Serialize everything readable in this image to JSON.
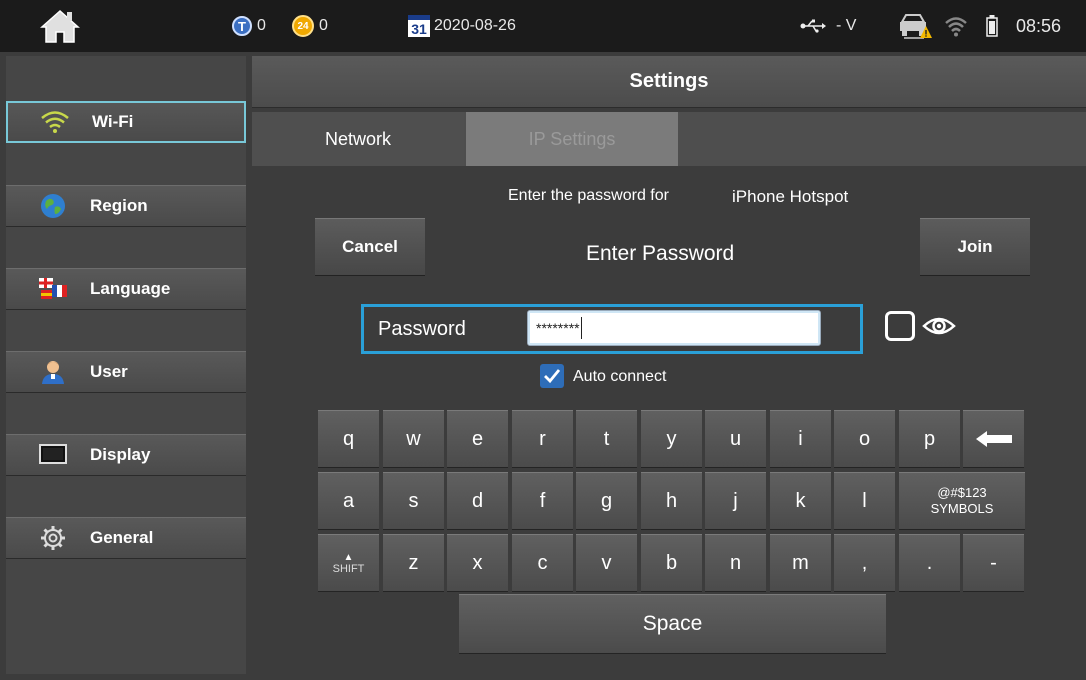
{
  "status_bar": {
    "t_badge": "T",
    "t_count": "0",
    "badge_24": "24",
    "count_24": "0",
    "calendar_day": "31",
    "date": "2020-08-26",
    "voltage": "- V",
    "time": "08:56"
  },
  "sidebar": {
    "items": [
      {
        "label": "Wi-Fi",
        "icon": "wifi-icon"
      },
      {
        "label": "Region",
        "icon": "globe-icon"
      },
      {
        "label": "Language",
        "icon": "flags-icon"
      },
      {
        "label": "User",
        "icon": "user-icon"
      },
      {
        "label": "Display",
        "icon": "monitor-icon"
      },
      {
        "label": "General",
        "icon": "gear-icon"
      }
    ],
    "active_index": 0
  },
  "header": {
    "title": "Settings"
  },
  "tabs": [
    {
      "label": "Network"
    },
    {
      "label": "IP Settings"
    }
  ],
  "password_dialog": {
    "prompt_prefix": "Enter the password for",
    "network_name": "iPhone Hotspot",
    "cancel_label": "Cancel",
    "title": "Enter Password",
    "join_label": "Join",
    "field_label": "Password",
    "field_value": "********",
    "auto_connect_label": "Auto connect",
    "auto_connect_checked": true
  },
  "keyboard": {
    "row1": [
      "q",
      "w",
      "e",
      "r",
      "t",
      "y",
      "u",
      "i",
      "o",
      "p"
    ],
    "row2": [
      "a",
      "s",
      "d",
      "f",
      "g",
      "h",
      "j",
      "k",
      "l"
    ],
    "symbols_line1": "@#$123",
    "symbols_line2": "SYMBOLS",
    "shift_label": "SHIFT",
    "row3": [
      "z",
      "x",
      "c",
      "v",
      "b",
      "n",
      "m",
      ",",
      ".",
      "-"
    ],
    "space_label": "Space"
  },
  "colors": {
    "accent_blue": "#2aa0d8",
    "active_outline": "#78c8d8",
    "warning_yellow": "#f2b800"
  }
}
